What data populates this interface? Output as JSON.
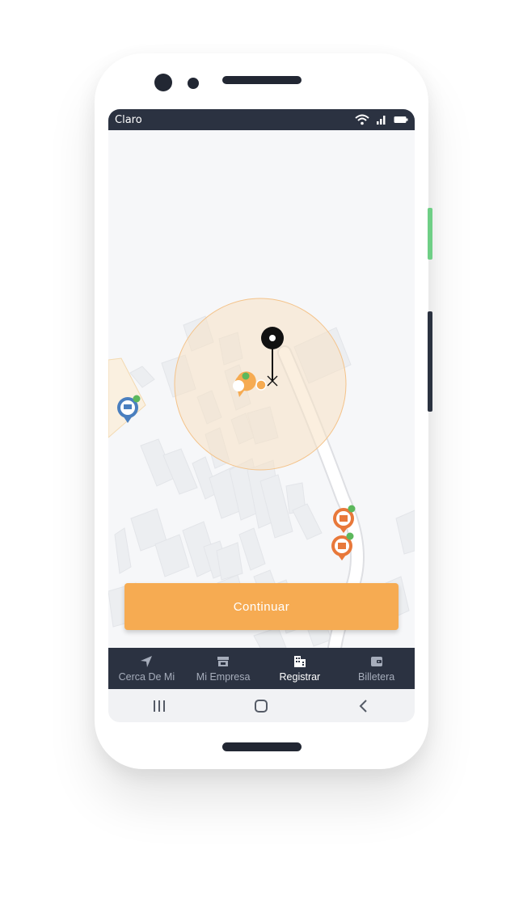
{
  "status_bar": {
    "carrier": "Claro",
    "icons": [
      "wifi-icon",
      "signal-icon",
      "battery-icon"
    ]
  },
  "map": {
    "markers": [
      "shop-pin-icon",
      "you-are-here-pin-icon",
      "store-pin-icon",
      "store-pin-icon"
    ]
  },
  "action": {
    "continue_label": "Continuar"
  },
  "bottom_nav": {
    "items": [
      {
        "label": "Cerca De Mi",
        "icon": "navigation-arrow-icon"
      },
      {
        "label": "Mi Empresa",
        "icon": "store-icon"
      },
      {
        "label": "Registrar",
        "icon": "building-icon",
        "active": true
      },
      {
        "label": "Billetera",
        "icon": "wallet-icon"
      }
    ]
  },
  "system_nav": [
    "recent-apps-icon",
    "home-icon",
    "back-icon"
  ],
  "colors": {
    "accent": "#f6ab52",
    "nav_bg": "#2b3241",
    "radius_fill": "#f8e9d6",
    "verified": "#5cb85c"
  }
}
